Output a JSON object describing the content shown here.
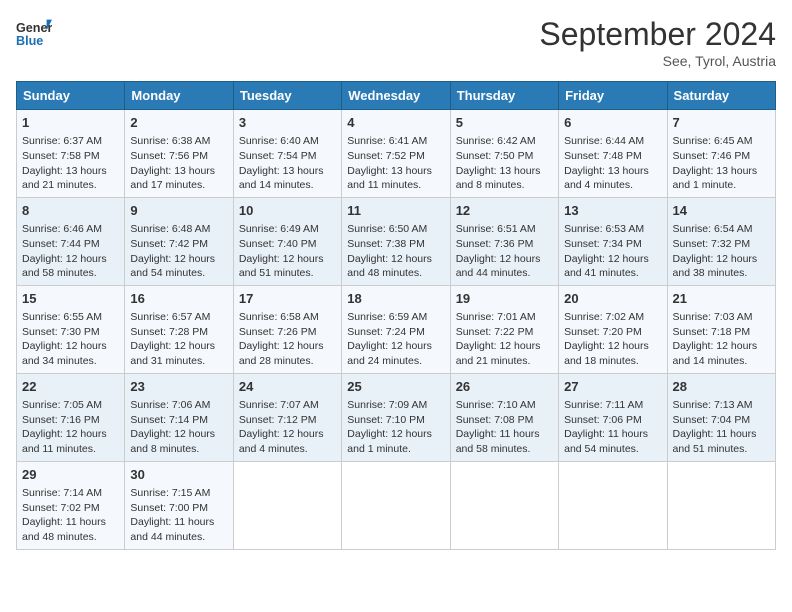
{
  "header": {
    "logo_line1": "General",
    "logo_line2": "Blue",
    "month": "September 2024",
    "location": "See, Tyrol, Austria"
  },
  "weekdays": [
    "Sunday",
    "Monday",
    "Tuesday",
    "Wednesday",
    "Thursday",
    "Friday",
    "Saturday"
  ],
  "weeks": [
    [
      {
        "day": "1",
        "lines": [
          "Sunrise: 6:37 AM",
          "Sunset: 7:58 PM",
          "Daylight: 13 hours",
          "and 21 minutes."
        ]
      },
      {
        "day": "2",
        "lines": [
          "Sunrise: 6:38 AM",
          "Sunset: 7:56 PM",
          "Daylight: 13 hours",
          "and 17 minutes."
        ]
      },
      {
        "day": "3",
        "lines": [
          "Sunrise: 6:40 AM",
          "Sunset: 7:54 PM",
          "Daylight: 13 hours",
          "and 14 minutes."
        ]
      },
      {
        "day": "4",
        "lines": [
          "Sunrise: 6:41 AM",
          "Sunset: 7:52 PM",
          "Daylight: 13 hours",
          "and 11 minutes."
        ]
      },
      {
        "day": "5",
        "lines": [
          "Sunrise: 6:42 AM",
          "Sunset: 7:50 PM",
          "Daylight: 13 hours",
          "and 8 minutes."
        ]
      },
      {
        "day": "6",
        "lines": [
          "Sunrise: 6:44 AM",
          "Sunset: 7:48 PM",
          "Daylight: 13 hours",
          "and 4 minutes."
        ]
      },
      {
        "day": "7",
        "lines": [
          "Sunrise: 6:45 AM",
          "Sunset: 7:46 PM",
          "Daylight: 13 hours",
          "and 1 minute."
        ]
      }
    ],
    [
      {
        "day": "8",
        "lines": [
          "Sunrise: 6:46 AM",
          "Sunset: 7:44 PM",
          "Daylight: 12 hours",
          "and 58 minutes."
        ]
      },
      {
        "day": "9",
        "lines": [
          "Sunrise: 6:48 AM",
          "Sunset: 7:42 PM",
          "Daylight: 12 hours",
          "and 54 minutes."
        ]
      },
      {
        "day": "10",
        "lines": [
          "Sunrise: 6:49 AM",
          "Sunset: 7:40 PM",
          "Daylight: 12 hours",
          "and 51 minutes."
        ]
      },
      {
        "day": "11",
        "lines": [
          "Sunrise: 6:50 AM",
          "Sunset: 7:38 PM",
          "Daylight: 12 hours",
          "and 48 minutes."
        ]
      },
      {
        "day": "12",
        "lines": [
          "Sunrise: 6:51 AM",
          "Sunset: 7:36 PM",
          "Daylight: 12 hours",
          "and 44 minutes."
        ]
      },
      {
        "day": "13",
        "lines": [
          "Sunrise: 6:53 AM",
          "Sunset: 7:34 PM",
          "Daylight: 12 hours",
          "and 41 minutes."
        ]
      },
      {
        "day": "14",
        "lines": [
          "Sunrise: 6:54 AM",
          "Sunset: 7:32 PM",
          "Daylight: 12 hours",
          "and 38 minutes."
        ]
      }
    ],
    [
      {
        "day": "15",
        "lines": [
          "Sunrise: 6:55 AM",
          "Sunset: 7:30 PM",
          "Daylight: 12 hours",
          "and 34 minutes."
        ]
      },
      {
        "day": "16",
        "lines": [
          "Sunrise: 6:57 AM",
          "Sunset: 7:28 PM",
          "Daylight: 12 hours",
          "and 31 minutes."
        ]
      },
      {
        "day": "17",
        "lines": [
          "Sunrise: 6:58 AM",
          "Sunset: 7:26 PM",
          "Daylight: 12 hours",
          "and 28 minutes."
        ]
      },
      {
        "day": "18",
        "lines": [
          "Sunrise: 6:59 AM",
          "Sunset: 7:24 PM",
          "Daylight: 12 hours",
          "and 24 minutes."
        ]
      },
      {
        "day": "19",
        "lines": [
          "Sunrise: 7:01 AM",
          "Sunset: 7:22 PM",
          "Daylight: 12 hours",
          "and 21 minutes."
        ]
      },
      {
        "day": "20",
        "lines": [
          "Sunrise: 7:02 AM",
          "Sunset: 7:20 PM",
          "Daylight: 12 hours",
          "and 18 minutes."
        ]
      },
      {
        "day": "21",
        "lines": [
          "Sunrise: 7:03 AM",
          "Sunset: 7:18 PM",
          "Daylight: 12 hours",
          "and 14 minutes."
        ]
      }
    ],
    [
      {
        "day": "22",
        "lines": [
          "Sunrise: 7:05 AM",
          "Sunset: 7:16 PM",
          "Daylight: 12 hours",
          "and 11 minutes."
        ]
      },
      {
        "day": "23",
        "lines": [
          "Sunrise: 7:06 AM",
          "Sunset: 7:14 PM",
          "Daylight: 12 hours",
          "and 8 minutes."
        ]
      },
      {
        "day": "24",
        "lines": [
          "Sunrise: 7:07 AM",
          "Sunset: 7:12 PM",
          "Daylight: 12 hours",
          "and 4 minutes."
        ]
      },
      {
        "day": "25",
        "lines": [
          "Sunrise: 7:09 AM",
          "Sunset: 7:10 PM",
          "Daylight: 12 hours",
          "and 1 minute."
        ]
      },
      {
        "day": "26",
        "lines": [
          "Sunrise: 7:10 AM",
          "Sunset: 7:08 PM",
          "Daylight: 11 hours",
          "and 58 minutes."
        ]
      },
      {
        "day": "27",
        "lines": [
          "Sunrise: 7:11 AM",
          "Sunset: 7:06 PM",
          "Daylight: 11 hours",
          "and 54 minutes."
        ]
      },
      {
        "day": "28",
        "lines": [
          "Sunrise: 7:13 AM",
          "Sunset: 7:04 PM",
          "Daylight: 11 hours",
          "and 51 minutes."
        ]
      }
    ],
    [
      {
        "day": "29",
        "lines": [
          "Sunrise: 7:14 AM",
          "Sunset: 7:02 PM",
          "Daylight: 11 hours",
          "and 48 minutes."
        ]
      },
      {
        "day": "30",
        "lines": [
          "Sunrise: 7:15 AM",
          "Sunset: 7:00 PM",
          "Daylight: 11 hours",
          "and 44 minutes."
        ]
      },
      {
        "day": "",
        "lines": []
      },
      {
        "day": "",
        "lines": []
      },
      {
        "day": "",
        "lines": []
      },
      {
        "day": "",
        "lines": []
      },
      {
        "day": "",
        "lines": []
      }
    ]
  ]
}
